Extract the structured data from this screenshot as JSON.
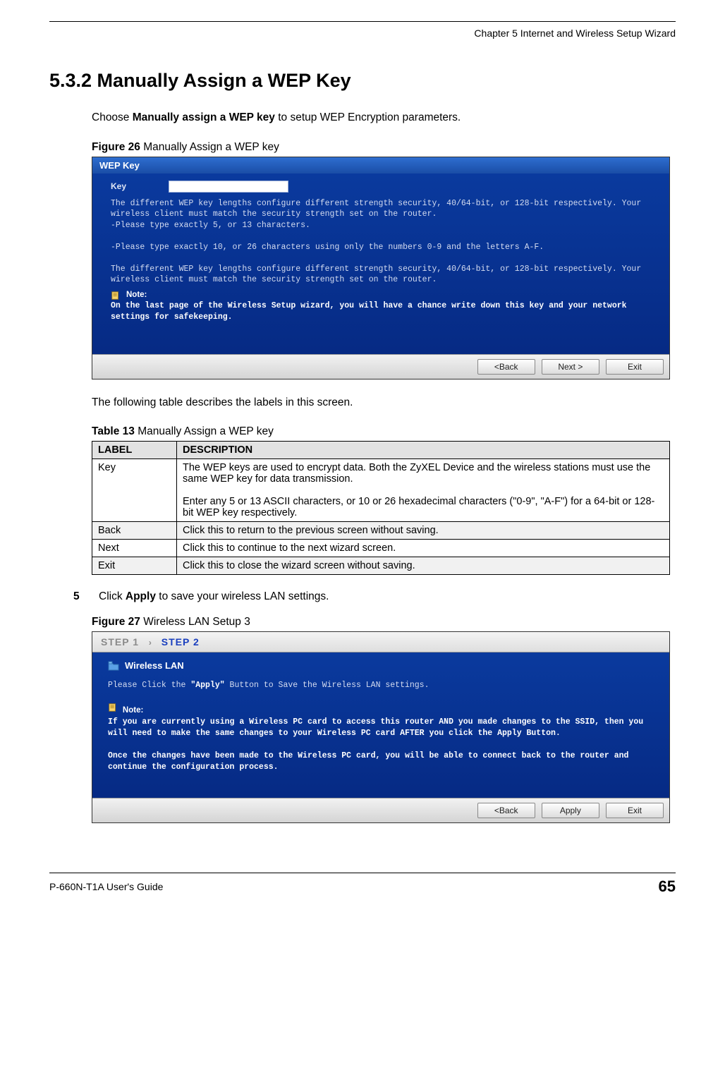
{
  "header": {
    "chapter": "Chapter 5 Internet and Wireless Setup Wizard"
  },
  "section": {
    "number_title": "5.3.2  Manually Assign a WEP Key",
    "intro_prefix": "Choose ",
    "intro_bold": "Manually assign a WEP key",
    "intro_suffix": " to setup WEP Encryption parameters."
  },
  "figure26": {
    "label_bold": "Figure 26",
    "label_rest": "   Manually Assign a WEP key",
    "titlebar": "WEP Key",
    "key_label": "Key",
    "line1": "The different WEP key lengths configure different strength security, 40/64-bit, or 128-bit respectively. Your wireless client must match the security strength set on the router.",
    "line2": "-Please type exactly 5, or 13 characters.",
    "line3": "-Please type exactly 10, or 26 characters using only the numbers 0-9 and the letters A-F.",
    "line4": "The different WEP key lengths configure different strength security, 40/64-bit, or 128-bit respectively. Your wireless client must match the security strength set on the router.",
    "note_label": "Note:",
    "note_text": "On the last page of the Wireless Setup wizard, you will have a chance write down this key and your network settings for safekeeping.",
    "buttons": {
      "back": "<Back",
      "next": "Next >",
      "exit": "Exit"
    }
  },
  "after_fig26": "The following table describes the labels in this screen.",
  "table13": {
    "label_bold": "Table 13",
    "label_rest": "   Manually Assign a WEP key",
    "head_label": "LABEL",
    "head_desc": "DESCRIPTION",
    "rows": [
      {
        "label": "Key",
        "desc1": "The WEP keys are used to encrypt data. Both the ZyXEL Device and the wireless stations must use the same WEP key for data transmission.",
        "desc2": "Enter any 5 or 13 ASCII characters, or 10 or 26 hexadecimal characters (\"0-9\", \"A-F\") for a 64-bit or 128-bit WEP key respectively."
      },
      {
        "label": "Back",
        "desc1": "Click this to return to the previous screen without saving."
      },
      {
        "label": "Next",
        "desc1": "Click this to continue to the next wizard screen."
      },
      {
        "label": "Exit",
        "desc1": "Click this to close the wizard screen without saving."
      }
    ]
  },
  "step5": {
    "num": "5",
    "pre": "Click ",
    "bold": "Apply",
    "post": " to save your wireless LAN settings."
  },
  "figure27": {
    "label_bold": "Figure 27",
    "label_rest": "   Wireless LAN Setup 3",
    "step1": "STEP 1",
    "arrow": "›",
    "step2": "STEP 2",
    "wlan_title": "Wireless LAN",
    "line1a": "Please Click the ",
    "line1b": "\"Apply\"",
    "line1c": " Button to Save the Wireless LAN settings.",
    "note_label": "Note:",
    "note_text1": "If you are currently using a Wireless PC card to access this router AND you made changes to the SSID, then you will need to make the same changes to your Wireless PC card AFTER you click the Apply Button.",
    "note_text2": "Once the changes have been made to the Wireless PC card, you will be able to connect back to the router and continue the configuration process.",
    "buttons": {
      "back": "<Back",
      "apply": "Apply",
      "exit": "Exit"
    }
  },
  "footer": {
    "guide": "P-660N-T1A User's Guide",
    "page": "65"
  }
}
